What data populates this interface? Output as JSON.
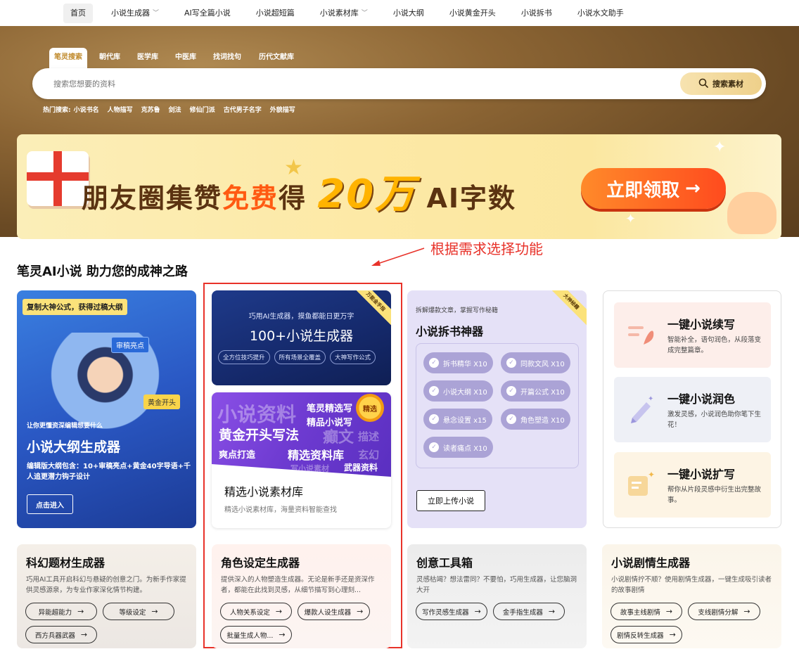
{
  "nav": {
    "items": [
      {
        "label": "首页"
      },
      {
        "label": "小说生成器"
      },
      {
        "label": "AI写全篇小说"
      },
      {
        "label": "小说超短篇"
      },
      {
        "label": "小说素材库"
      },
      {
        "label": "小说大纲"
      },
      {
        "label": "小说黄金开头"
      },
      {
        "label": "小说拆书"
      },
      {
        "label": "小说水文助手"
      }
    ]
  },
  "search": {
    "tabs": [
      "笔灵搜索",
      "朝代库",
      "医学库",
      "中医库",
      "找词找句",
      "历代文献库"
    ],
    "placeholder": "搜索您想要的资料",
    "button": "搜索素材",
    "hot_label": "热门搜索:",
    "hot": [
      "小说书名",
      "人物描写",
      "克苏鲁",
      "剑法",
      "修仙门派",
      "古代男子名字",
      "外貌描写"
    ]
  },
  "banner": {
    "part1": "朋友圈集赞",
    "free": "免费",
    "part2": "得",
    "amount": "20万",
    "part3": "AI字数",
    "button": "立即领取"
  },
  "annotation": "根据需求选择功能",
  "heading": "笔灵AI小说 助力您的成神之路",
  "card_outline": {
    "tag": "复制大神公式，获得过稿大纲",
    "bubble1": "审稿亮点",
    "bubble2": "黄金开头",
    "sub": "让你更懂资深编辑想要什么",
    "title": "小说大纲生成器",
    "desc": "编辑版大纲包含：10+审稿亮点+黄金40字导语+千人追更潜力钩子设计",
    "button": "点击进入"
  },
  "card_generators": {
    "corner": "万能金手指",
    "sub": "巧用AI生成器，摸鱼都能日更万字",
    "title": "100+小说生成器",
    "pills": [
      "全方位技巧提升",
      "所有场景全覆盖",
      "大神写作公式"
    ]
  },
  "card_materials": {
    "badge": "精选",
    "img_words": [
      "小说资料",
      "笔灵精选写",
      "精品小说写",
      "黄金开头写法",
      "癫文",
      "描述",
      "爽点打造",
      "精选资料库",
      "玄幻",
      "武器资料",
      "写小说素材"
    ],
    "title": "精选小说素材库",
    "desc": "精选小说素材库，海量资料智能查找"
  },
  "card_split": {
    "corner": "大神秘籍",
    "sub": "拆解爆款文章，掌握写作秘籍",
    "title": "小说拆书神器",
    "tags": [
      "拆书精华 X10",
      "同款文风 X10",
      "小说大纲 X10",
      "开篇公式 X10",
      "悬念设置 x15",
      "角色塑造 X10",
      "读者痛点 X10"
    ],
    "button": "立即上传小说"
  },
  "card_tools": [
    {
      "title": "一键小说续写",
      "desc": "智能补全，语句润色，从段落变成完整篇章。"
    },
    {
      "title": "一键小说润色",
      "desc": "激发灵感，小说润色助你笔下生花！"
    },
    {
      "title": "一键小说扩写",
      "desc": "帮你从片段灵感中衍生出完整故事。"
    }
  ],
  "bottom_cards": [
    {
      "title": "科幻题材生成器",
      "desc": "巧用AI工具开启科幻与悬疑的创意之门。为新手作家提供灵感源泉，为专业作家深化情节构建。",
      "buttons": [
        "异能超能力",
        "等级设定",
        "西方兵器武器"
      ]
    },
    {
      "title": "角色设定生成器",
      "desc": "提供深入的人物塑造生成器。无论是新手还是资深作者，都能在此找到灵感，从细节描写到心理刻...",
      "buttons": [
        "人物关系设定",
        "爆款人设生成器",
        "批量生成人物..."
      ]
    },
    {
      "title": "创意工具箱",
      "desc": "灵感枯竭？想法雷同？不要怕，巧用生成器，让您脑洞大开",
      "buttons": [
        "写作灵感生成器",
        "金手指生成器"
      ]
    },
    {
      "title": "小说剧情生成器",
      "desc": "小说剧情拧不顺？使用剧情生成器，一键生成吸引读者的故事剧情",
      "buttons": [
        "故事主线剧情",
        "支线剧情分解",
        "剧情反转生成器"
      ]
    }
  ],
  "colors": {
    "annotation": "#e8322a",
    "accent": "#c08a2c",
    "banner_button": "#ff5a1e"
  }
}
